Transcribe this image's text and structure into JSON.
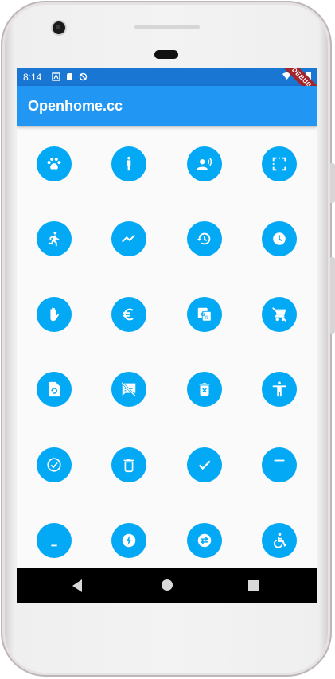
{
  "status_bar": {
    "time": "8:14",
    "notification_icons": [
      "accessibility-notification-icon",
      "sd-card-icon",
      "sync-disabled-icon"
    ],
    "right_icons": [
      "wifi-icon",
      "signal-icon",
      "battery-icon"
    ]
  },
  "debug_banner": "DEBUG",
  "app_bar": {
    "title": "Openhome.cc"
  },
  "icon_grid": {
    "button_color": "#03a9f4",
    "icons": [
      "pets-icon",
      "person-icon",
      "record-voice-icon",
      "crop-free-icon",
      "directions-run-icon",
      "trending-icon",
      "restore-icon",
      "schedule-icon",
      "pan-tool-icon",
      "euro-icon",
      "translate-icon",
      "remove-shopping-cart-icon",
      "restore-page-icon",
      "speaker-notes-off-icon",
      "delete-forever-icon",
      "accessibility-icon",
      "check-circle-icon",
      "delete-icon",
      "done-all-icon",
      "minimize-icon",
      "minimize-bottom-icon",
      "offline-bolt-icon",
      "swap-circle-icon",
      "accessible-icon"
    ]
  },
  "nav_bar": {
    "buttons": [
      "back-button",
      "home-button",
      "recents-button"
    ]
  },
  "colors": {
    "status_bar": "#1976d2",
    "app_bar": "#2196f3",
    "icon_button": "#03a9f4",
    "background": "#fafafa"
  }
}
